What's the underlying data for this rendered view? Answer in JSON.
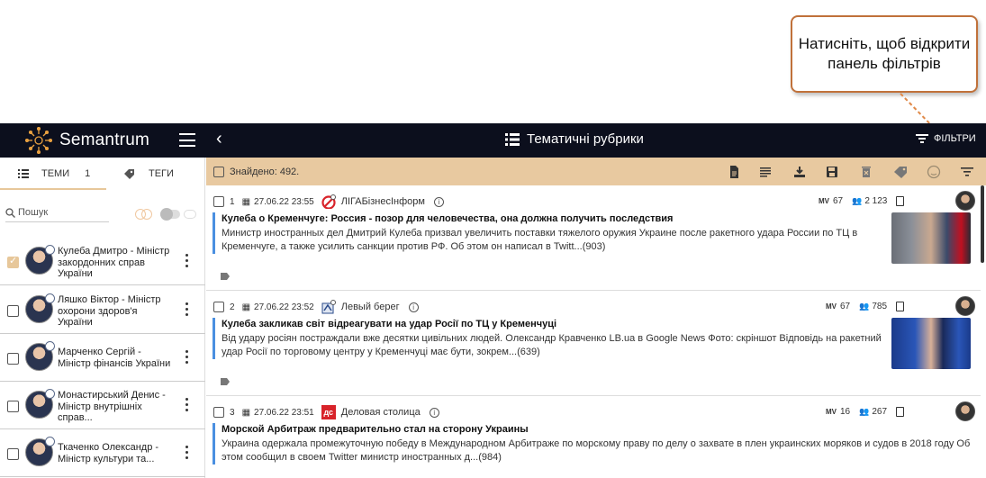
{
  "callout": {
    "text": "Натисніть, щоб відкрити панель фільтрів"
  },
  "topbar": {
    "brand": "Semantrum",
    "back_icon": "chevron-left-icon",
    "page_title": "Тематичні рубрики",
    "filters_label": "ФІЛЬТРИ",
    "bg_color": "#0c0f1d"
  },
  "sidebar": {
    "tab_topics_label": "ТЕМИ",
    "tab_topics_count": "1",
    "tab_tags_label": "ТЕГИ",
    "search_placeholder": "Пошук",
    "accent_color": "#e8c9a0",
    "people": [
      {
        "name": "Кулеба Дмитро - Міністр закордонних справ України",
        "checked": true
      },
      {
        "name": "Ляшко Віктор - Міністр охорони здоров'я України",
        "checked": false
      },
      {
        "name": "Марченко Сергій - Міністр фінансів України",
        "checked": false
      },
      {
        "name": "Монастирський Денис - Міністр внутрішніх справ...",
        "checked": false
      },
      {
        "name": "Ткаченко Олександр - Міністр культури та...",
        "checked": false
      }
    ]
  },
  "toolbar": {
    "found_text": "Знайдено: 492.",
    "icons": [
      "document-icon",
      "text-lines-icon",
      "download-icon",
      "save-icon",
      "delete-icon",
      "tag-icon",
      "emoji-icon",
      "sort-filter-icon"
    ]
  },
  "articles": [
    {
      "index": "1",
      "datetime": "27.06.22 23:55",
      "source": "ЛІГАБізнесІнформ",
      "mv": "67",
      "audience": "2 123",
      "title": "Кулеба о Кременчуге: Россия - позор для человечества, она должна получить последствия",
      "text": "Министр иностранных дел Дмитрий Кулеба призвал увеличить поставки тяжелого оружия Украине после ракетного удара России по ТЦ в Кременчуге, а также усилить санкции против РФ. Об этом он написал в Twitt...(903)"
    },
    {
      "index": "2",
      "datetime": "27.06.22 23:52",
      "source": "Левый берег",
      "mv": "67",
      "audience": "785",
      "title": "Кулеба закликав світ відреагувати на удар Росії по ТЦ у Кременчуці",
      "text": "Від удару росіян постраждали вже десятки цивільних людей. Олександр Кравченко LB.ua в Google News Фото: скріншот Відповідь на ракетний удар Росії по торговому центру у Кременчуці має бути, зокрем...(639)"
    },
    {
      "index": "3",
      "datetime": "27.06.22 23:51",
      "source": "Деловая столица",
      "mv": "16",
      "audience": "267",
      "title": "Морской Арбитраж предварительно стал на сторону Украины",
      "text": "Украина одержала промежуточную победу в Международном Арбитраже по морскому праву по делу о захвате в плен украинских моряков и судов в 2018 году Об этом сообщил в своем Twitter министр иностранных д...(984)"
    }
  ],
  "labels": {
    "mv_prefix": "MV",
    "src_logo_3": "дс"
  }
}
